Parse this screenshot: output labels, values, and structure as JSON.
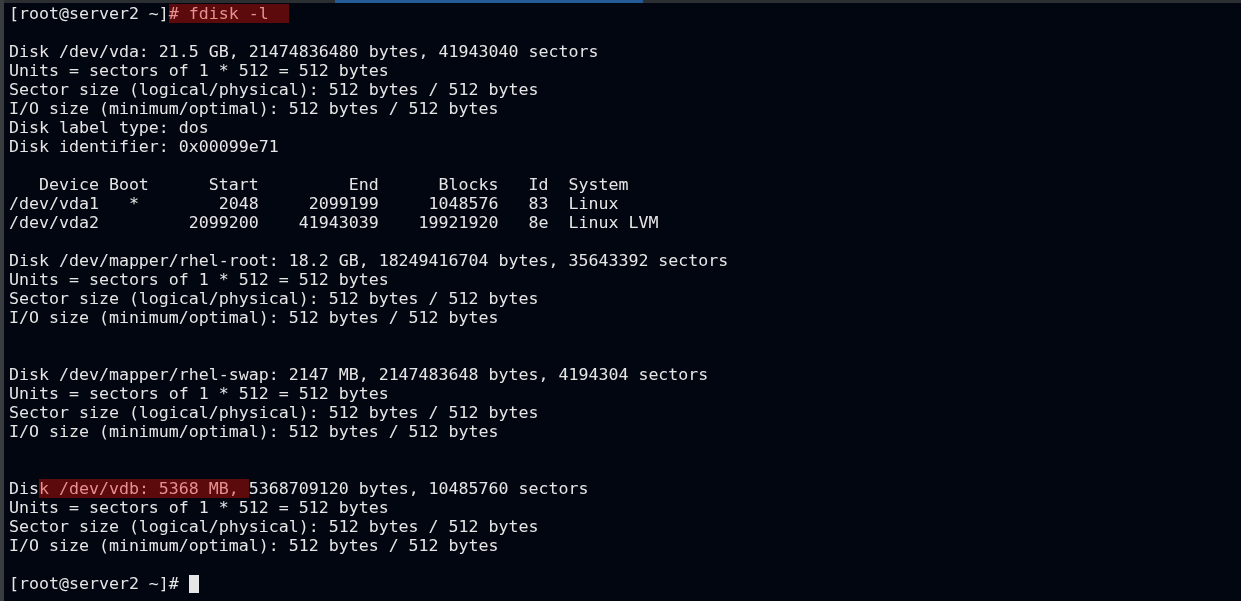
{
  "terminal": {
    "lines": [
      {
        "kind": "text",
        "segments": [
          {
            "text": "[root@server2 ~]",
            "highlighted": false
          },
          {
            "text": "# fdisk -l  ",
            "highlighted": true
          }
        ]
      },
      {
        "kind": "blank"
      },
      {
        "kind": "text",
        "segments": [
          {
            "text": "Disk /dev/vda: 21.5 GB, 21474836480 bytes, 41943040 sectors",
            "highlighted": false
          }
        ]
      },
      {
        "kind": "text",
        "segments": [
          {
            "text": "Units = sectors of 1 * 512 = 512 bytes",
            "highlighted": false
          }
        ]
      },
      {
        "kind": "text",
        "segments": [
          {
            "text": "Sector size (logical/physical): 512 bytes / 512 bytes",
            "highlighted": false
          }
        ]
      },
      {
        "kind": "text",
        "segments": [
          {
            "text": "I/O size (minimum/optimal): 512 bytes / 512 bytes",
            "highlighted": false
          }
        ]
      },
      {
        "kind": "text",
        "segments": [
          {
            "text": "Disk label type: dos",
            "highlighted": false
          }
        ]
      },
      {
        "kind": "text",
        "segments": [
          {
            "text": "Disk identifier: 0x00099e71",
            "highlighted": false
          }
        ]
      },
      {
        "kind": "blank"
      },
      {
        "kind": "text",
        "segments": [
          {
            "text": "   Device Boot      Start         End      Blocks   Id  System",
            "highlighted": false
          }
        ]
      },
      {
        "kind": "text",
        "segments": [
          {
            "text": "/dev/vda1   *        2048     2099199     1048576   83  Linux",
            "highlighted": false
          }
        ]
      },
      {
        "kind": "text",
        "segments": [
          {
            "text": "/dev/vda2         2099200    41943039    19921920   8e  Linux LVM",
            "highlighted": false
          }
        ]
      },
      {
        "kind": "blank"
      },
      {
        "kind": "text",
        "segments": [
          {
            "text": "Disk /dev/mapper/rhel-root: 18.2 GB, 18249416704 bytes, 35643392 sectors",
            "highlighted": false
          }
        ]
      },
      {
        "kind": "text",
        "segments": [
          {
            "text": "Units = sectors of 1 * 512 = 512 bytes",
            "highlighted": false
          }
        ]
      },
      {
        "kind": "text",
        "segments": [
          {
            "text": "Sector size (logical/physical): 512 bytes / 512 bytes",
            "highlighted": false
          }
        ]
      },
      {
        "kind": "text",
        "segments": [
          {
            "text": "I/O size (minimum/optimal): 512 bytes / 512 bytes",
            "highlighted": false
          }
        ]
      },
      {
        "kind": "blank"
      },
      {
        "kind": "blank"
      },
      {
        "kind": "text",
        "segments": [
          {
            "text": "Disk /dev/mapper/rhel-swap: 2147 MB, 2147483648 bytes, 4194304 sectors",
            "highlighted": false
          }
        ]
      },
      {
        "kind": "text",
        "segments": [
          {
            "text": "Units = sectors of 1 * 512 = 512 bytes",
            "highlighted": false
          }
        ]
      },
      {
        "kind": "text",
        "segments": [
          {
            "text": "Sector size (logical/physical): 512 bytes / 512 bytes",
            "highlighted": false
          }
        ]
      },
      {
        "kind": "text",
        "segments": [
          {
            "text": "I/O size (minimum/optimal): 512 bytes / 512 bytes",
            "highlighted": false
          }
        ]
      },
      {
        "kind": "blank"
      },
      {
        "kind": "blank"
      },
      {
        "kind": "text",
        "segments": [
          {
            "text": "Dis",
            "highlighted": false
          },
          {
            "text": "k /dev/vdb: 5368 MB, ",
            "highlighted": true
          },
          {
            "text": "5368709120 bytes, 10485760 sectors",
            "highlighted": false
          }
        ]
      },
      {
        "kind": "text",
        "segments": [
          {
            "text": "Units = sectors of 1 * 512 = 512 bytes",
            "highlighted": false
          }
        ]
      },
      {
        "kind": "text",
        "segments": [
          {
            "text": "Sector size (logical/physical): 512 bytes / 512 bytes",
            "highlighted": false
          }
        ]
      },
      {
        "kind": "text",
        "segments": [
          {
            "text": "I/O size (minimum/optimal): 512 bytes / 512 bytes",
            "highlighted": false
          }
        ]
      },
      {
        "kind": "blank"
      },
      {
        "kind": "text",
        "cursor": true,
        "segments": [
          {
            "text": "[root@server2 ~]# ",
            "highlighted": false
          }
        ]
      }
    ]
  }
}
